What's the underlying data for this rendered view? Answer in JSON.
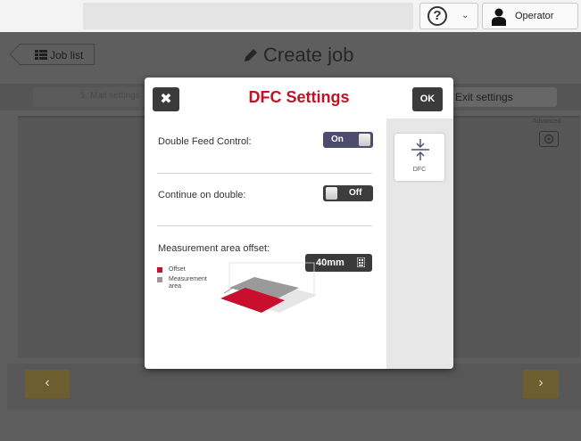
{
  "topbar": {
    "help_icon": "question-circle-icon",
    "user_label": "Operator"
  },
  "header": {
    "back_label": "Job list",
    "title": "Create job"
  },
  "steps": {
    "step1_label": "1. Mail settings",
    "exit_label": "Exit settings"
  },
  "advanced_label": "Advanced",
  "dialog": {
    "title": "DFC Settings",
    "close_icon": "close-x-icon",
    "ok_label": "OK",
    "double_feed_label": "Double Feed Control:",
    "double_feed_state": "On",
    "continue_label": "Continue on double:",
    "continue_state": "Off",
    "offset_label": "Measurement area offset:",
    "offset_value": "40mm",
    "legend": [
      {
        "label": "Offset",
        "color": "#c8102e"
      },
      {
        "label": "Measurement area",
        "color": "#9a9a9a"
      }
    ],
    "side_tab_label": "DFC"
  },
  "colors": {
    "accent_red": "#c01426",
    "toggle_on": "#4d4b6e",
    "nav_arrow": "#6d5e30"
  }
}
